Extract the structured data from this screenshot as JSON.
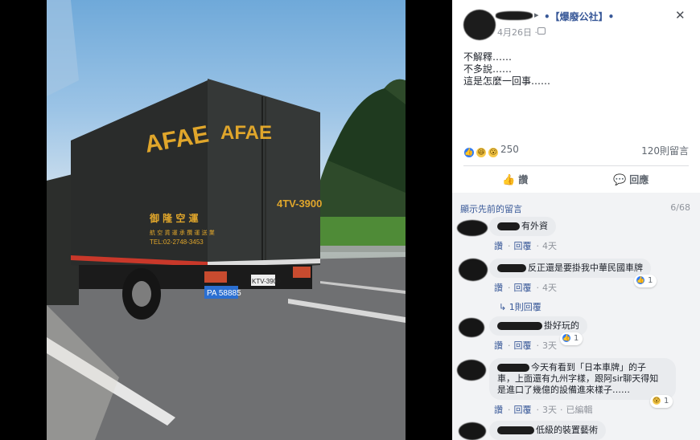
{
  "photo": {
    "truck_brand": "AFAE",
    "truck_brand_door": "AFAE",
    "side_text_line1": "御 隆 空 運",
    "side_text_line2": "航 空 貨 運 承 攬 運 送 業",
    "side_text_line3": "TEL:02-2748-3453",
    "rear_plate_large": "4TV-3900",
    "rear_plate_small": "KTV-3900",
    "tail_plate": "PA 58885"
  },
  "post": {
    "arrow": "▸",
    "group": "•【爆廢公社】•",
    "time": "4月26日 ·",
    "close": "✕",
    "lines": [
      "不解釋……",
      "不多說……",
      "這是怎麼一回事……"
    ],
    "reaction_icons": [
      "like-icon",
      "haha-icon",
      "wow-icon"
    ],
    "reaction_count": "250",
    "comment_count": "120則留言",
    "like_label": "讚",
    "comment_label": "回應"
  },
  "comments_section": {
    "previous_label": "顯示先前的留言",
    "page": "6/68",
    "items": [
      {
        "text": "有外資",
        "like": "讚",
        "reply": "回覆",
        "time": "4天"
      },
      {
        "text": "反正還是要掛我中華民國車牌",
        "like": "讚",
        "reply": "回覆",
        "time": "4天",
        "reactions": "1"
      },
      {
        "text": "掛好玩的",
        "like": "讚",
        "reply": "回覆",
        "time": "3天",
        "reactions": "1"
      },
      {
        "text_lines": [
          "今天有看到「日本車牌」的子",
          "車，上面還有九州字樣，跟阿sir聊天得知",
          "是進口了幾億的設備進來樣子……"
        ],
        "like": "讚",
        "reply": "回覆",
        "time": "3天",
        "edited": "已編輯",
        "reactions": "1"
      },
      {
        "text": "低級的裝置藝術"
      }
    ],
    "reply_count": "1則回覆"
  },
  "colors": {
    "link": "#385898",
    "meta": "#90949c",
    "panel_bg": "#f2f3f5",
    "like_blue": "#2e7bf6",
    "truck_yellow": "#e0a62b"
  }
}
